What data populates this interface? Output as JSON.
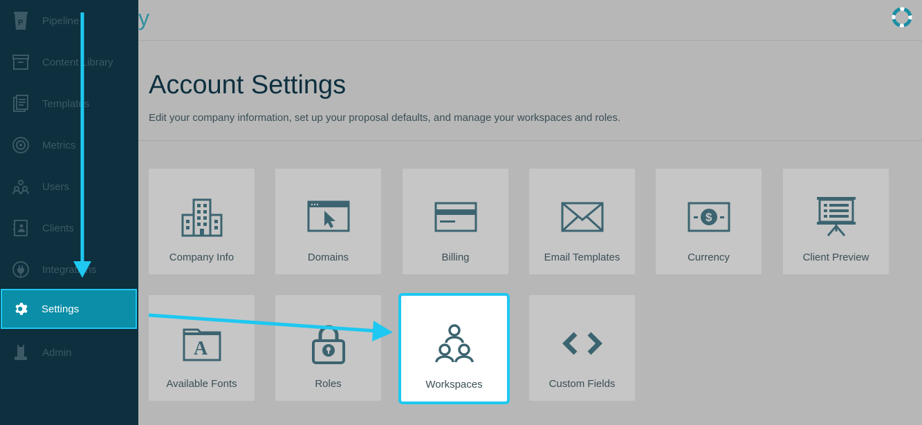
{
  "sidebar": {
    "items": [
      {
        "label": "Pipeline",
        "icon": "pipeline-icon"
      },
      {
        "label": "Content Library",
        "icon": "content-library-icon"
      },
      {
        "label": "Templates",
        "icon": "templates-icon"
      },
      {
        "label": "Metrics",
        "icon": "metrics-icon"
      },
      {
        "label": "Users",
        "icon": "users-icon"
      },
      {
        "label": "Clients",
        "icon": "clients-icon"
      },
      {
        "label": "Integrations",
        "icon": "integrations-icon"
      },
      {
        "label": "Settings",
        "icon": "gear-icon",
        "active": true
      },
      {
        "label": "Admin",
        "icon": "admin-icon"
      }
    ]
  },
  "topbar": {
    "brand_fragment": "y",
    "help_icon": "lifebuoy-icon"
  },
  "header": {
    "title": "Account Settings",
    "subtitle": "Edit your company information, set up your proposal defaults, and manage your workspaces and roles."
  },
  "tiles": [
    {
      "label": "Company Info",
      "icon": "building-icon"
    },
    {
      "label": "Domains",
      "icon": "browser-cursor-icon"
    },
    {
      "label": "Billing",
      "icon": "credit-card-icon"
    },
    {
      "label": "Email Templates",
      "icon": "envelope-icon"
    },
    {
      "label": "Currency",
      "icon": "currency-icon"
    },
    {
      "label": "Client Preview",
      "icon": "presentation-icon"
    },
    {
      "label": "Available Fonts",
      "icon": "font-folder-icon"
    },
    {
      "label": "Roles",
      "icon": "lock-icon"
    },
    {
      "label": "Workspaces",
      "icon": "workspaces-icon",
      "selected": true
    },
    {
      "label": "Custom Fields",
      "icon": "code-brackets-icon"
    }
  ],
  "colors": {
    "sidebar_bg": "#0d2f3e",
    "accent": "#1ec8f0",
    "active_item_bg": "#0b8ea7",
    "icon_color": "#3c6470",
    "page_bg": "#b7b7b7"
  }
}
